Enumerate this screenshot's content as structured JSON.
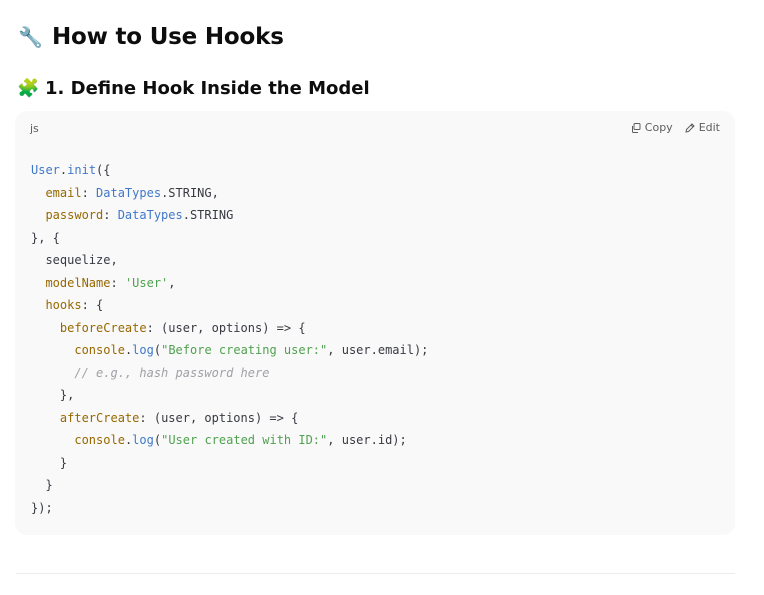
{
  "heading": {
    "emoji": "🔧",
    "title": "How to Use Hooks"
  },
  "subheading": {
    "emoji": "🧩",
    "title": "1. Define Hook Inside the Model"
  },
  "code_block": {
    "language": "js",
    "copy_label": "Copy",
    "edit_label": "Edit",
    "lines": [
      [
        {
          "t": "User",
          "c": "obj"
        },
        {
          "t": ".",
          "c": ""
        },
        {
          "t": "init",
          "c": "obj"
        },
        {
          "t": "({",
          "c": ""
        }
      ],
      [
        {
          "t": "  ",
          "c": ""
        },
        {
          "t": "email",
          "c": "prop"
        },
        {
          "t": ": ",
          "c": ""
        },
        {
          "t": "DataTypes",
          "c": "obj"
        },
        {
          "t": ".STRING,",
          "c": ""
        }
      ],
      [
        {
          "t": "  ",
          "c": ""
        },
        {
          "t": "password",
          "c": "prop"
        },
        {
          "t": ": ",
          "c": ""
        },
        {
          "t": "DataTypes",
          "c": "obj"
        },
        {
          "t": ".STRING",
          "c": ""
        }
      ],
      [
        {
          "t": "}, {",
          "c": ""
        }
      ],
      [
        {
          "t": "  sequelize,",
          "c": ""
        }
      ],
      [
        {
          "t": "  ",
          "c": ""
        },
        {
          "t": "modelName",
          "c": "prop"
        },
        {
          "t": ": ",
          "c": ""
        },
        {
          "t": "'User'",
          "c": "str"
        },
        {
          "t": ",",
          "c": ""
        }
      ],
      [
        {
          "t": "  ",
          "c": ""
        },
        {
          "t": "hooks",
          "c": "prop"
        },
        {
          "t": ": {",
          "c": ""
        }
      ],
      [
        {
          "t": "    ",
          "c": ""
        },
        {
          "t": "beforeCreate",
          "c": "prop"
        },
        {
          "t": ": (user, options) => {",
          "c": ""
        }
      ],
      [
        {
          "t": "      ",
          "c": ""
        },
        {
          "t": "console",
          "c": "prop"
        },
        {
          "t": ".",
          "c": ""
        },
        {
          "t": "log",
          "c": "obj"
        },
        {
          "t": "(",
          "c": ""
        },
        {
          "t": "\"Before creating user:\"",
          "c": "str"
        },
        {
          "t": ", user.email);",
          "c": ""
        }
      ],
      [
        {
          "t": "      ",
          "c": ""
        },
        {
          "t": "// e.g., hash password here",
          "c": "cmt"
        }
      ],
      [
        {
          "t": "    },",
          "c": ""
        }
      ],
      [
        {
          "t": "    ",
          "c": ""
        },
        {
          "t": "afterCreate",
          "c": "prop"
        },
        {
          "t": ": (user, options) => {",
          "c": ""
        }
      ],
      [
        {
          "t": "      ",
          "c": ""
        },
        {
          "t": "console",
          "c": "prop"
        },
        {
          "t": ".",
          "c": ""
        },
        {
          "t": "log",
          "c": "obj"
        },
        {
          "t": "(",
          "c": ""
        },
        {
          "t": "\"User created with ID:\"",
          "c": "str"
        },
        {
          "t": ", user.id);",
          "c": ""
        }
      ],
      [
        {
          "t": "    }",
          "c": ""
        }
      ],
      [
        {
          "t": "  }",
          "c": ""
        }
      ],
      [
        {
          "t": "});",
          "c": ""
        }
      ]
    ]
  },
  "colors": {
    "object": "#4078c8",
    "property": "#986801",
    "string": "#50a14f",
    "comment": "#a0a1a7",
    "code_bg": "#f9f9f9"
  },
  "icons": {
    "copy": "copy-icon",
    "edit": "pencil-icon"
  }
}
